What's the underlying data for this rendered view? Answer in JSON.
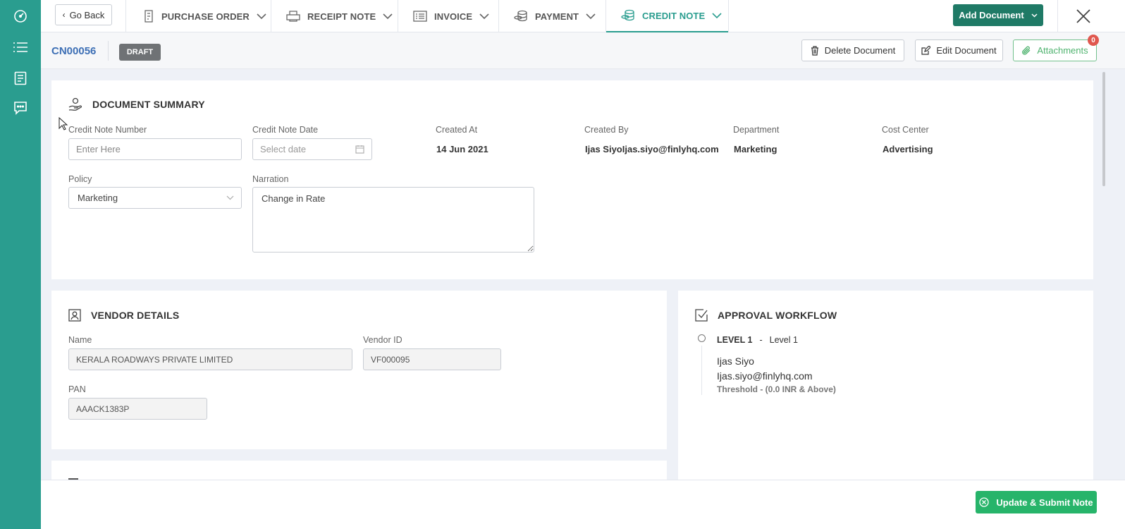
{
  "nav": {
    "go_back": "Go Back",
    "tabs": [
      {
        "label": "PURCHASE ORDER"
      },
      {
        "label": "RECEIPT NOTE"
      },
      {
        "label": "INVOICE"
      },
      {
        "label": "PAYMENT"
      },
      {
        "label": "CREDIT NOTE",
        "active": true
      }
    ],
    "add_document": "Add Document"
  },
  "doc": {
    "id": "CN00056",
    "status": "DRAFT",
    "delete_label": "Delete Document",
    "edit_label": "Edit Document",
    "attachments_label": "Attachments",
    "attachments_count": "0"
  },
  "summary": {
    "title": "DOCUMENT SUMMARY",
    "credit_note_number_label": "Credit Note Number",
    "credit_note_number_placeholder": "Enter Here",
    "credit_note_date_label": "Credit Note Date",
    "credit_note_date_placeholder": "Select date",
    "created_at_label": "Created At",
    "created_at": "14 Jun 2021",
    "created_by_label": "Created By",
    "created_by": "Ijas SiyoIjas.siyo@finlyhq.com",
    "department_label": "Department",
    "department": "Marketing",
    "cost_center_label": "Cost Center",
    "cost_center": "Advertising",
    "policy_label": "Policy",
    "policy": "Marketing",
    "narration_label": "Narration",
    "narration": "Change in Rate"
  },
  "vendor": {
    "title": "VENDOR DETAILS",
    "name_label": "Name",
    "name": "KERALA ROADWAYS PRIVATE LIMITED",
    "vendor_id_label": "Vendor ID",
    "vendor_id": "VF000095",
    "pan_label": "PAN",
    "pan": "AAACK1383P"
  },
  "approval": {
    "title": "APPROVAL WORKFLOW",
    "level_code": "LEVEL 1",
    "level_sep": "-",
    "level_name": "Level 1",
    "approver_name": "Ijas Siyo",
    "approver_email": "Ijas.siyo@finlyhq.com",
    "threshold": "Threshold -  (0.0 INR & Above)"
  },
  "footer": {
    "submit_label": "Update & Submit Note"
  },
  "colors": {
    "rail": "#2a9d8f",
    "accent": "#2a9d8f",
    "primary_button": "#1f7a66",
    "submit_button": "#27b46a",
    "doc_id": "#3d6fb5",
    "badge": "#e0584f"
  }
}
